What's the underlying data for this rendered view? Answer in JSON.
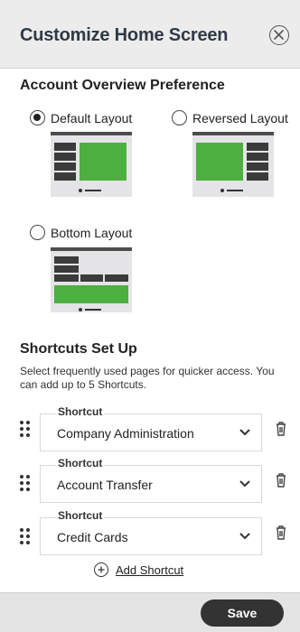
{
  "header": {
    "title": "Customize Home Screen"
  },
  "account_overview": {
    "title": "Account Overview Preference",
    "options": [
      {
        "label": "Default Layout",
        "selected": true
      },
      {
        "label": "Reversed Layout",
        "selected": false
      },
      {
        "label": "Bottom Layout",
        "selected": false
      }
    ]
  },
  "shortcuts": {
    "title": "Shortcuts Set Up",
    "description": "Select frequently used pages for quicker access. You can add up to 5 Shortcuts.",
    "items": [
      {
        "label": "Shortcut",
        "value": "Company Administration"
      },
      {
        "label": "Shortcut",
        "value": "Account Transfer"
      },
      {
        "label": "Shortcut",
        "value": "Credit Cards"
      }
    ],
    "add_label": "Add Shortcut"
  },
  "footer": {
    "save_label": "Save"
  },
  "colors": {
    "accent_green": "#4caf3f",
    "dark": "#333333"
  }
}
